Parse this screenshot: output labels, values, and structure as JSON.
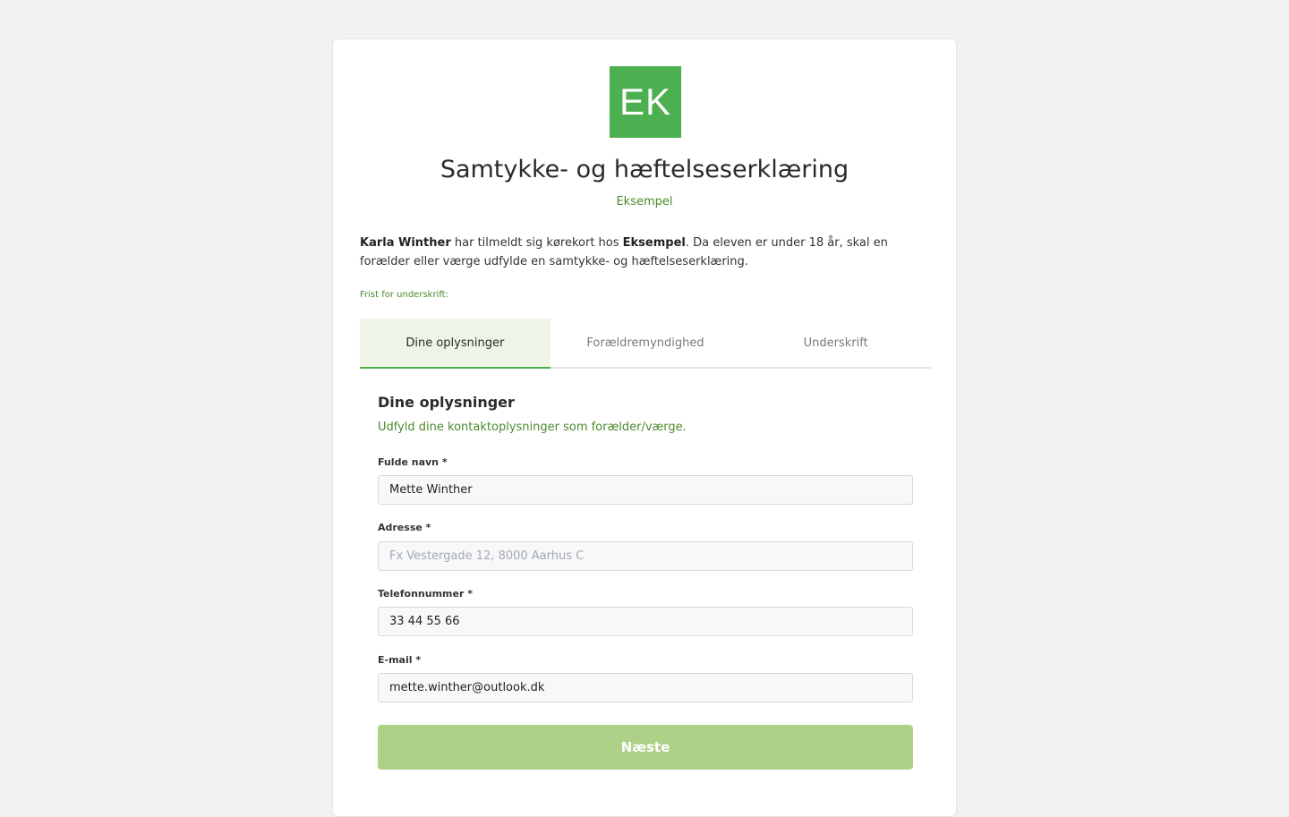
{
  "logo": {
    "text": "EK",
    "color": "#4caf50"
  },
  "header": {
    "title": "Samtykke- og hæftelseserklæring",
    "subtitle": "Eksempel"
  },
  "intro": {
    "student_name": "Karla Winther",
    "text_part1": " har tilmeldt sig kørekort hos ",
    "school_name": "Eksempel",
    "text_part2": ". Da eleven er under 18 år, skal en forælder eller værge udfylde en samtykke- og hæftelseserklæring."
  },
  "deadline": {
    "label": "Frist for underskrift:"
  },
  "tabs": [
    {
      "label": "Dine oplysninger",
      "active": true
    },
    {
      "label": "Forældremyndighed",
      "active": false
    },
    {
      "label": "Underskrift",
      "active": false
    }
  ],
  "form": {
    "section_title": "Dine oplysninger",
    "section_desc": "Udfyld dine kontaktoplysninger som forælder/værge.",
    "fields": {
      "full_name": {
        "label": "Fulde navn *",
        "value": "Mette Winther",
        "placeholder": ""
      },
      "address": {
        "label": "Adresse *",
        "value": "",
        "placeholder": "Fx Vestergade 12, 8000 Aarhus C"
      },
      "phone": {
        "label": "Telefonnummer *",
        "value": "33 44 55 66",
        "placeholder": ""
      },
      "email": {
        "label": "E-mail *",
        "value": "mette.winther@outlook.dk",
        "placeholder": ""
      }
    },
    "next_label": "Næste"
  },
  "colors": {
    "accent": "#4caf50",
    "accent_text": "#4b8a2c",
    "button_disabled": "#aed18a",
    "tab_active_bg": "#eef5e6"
  }
}
